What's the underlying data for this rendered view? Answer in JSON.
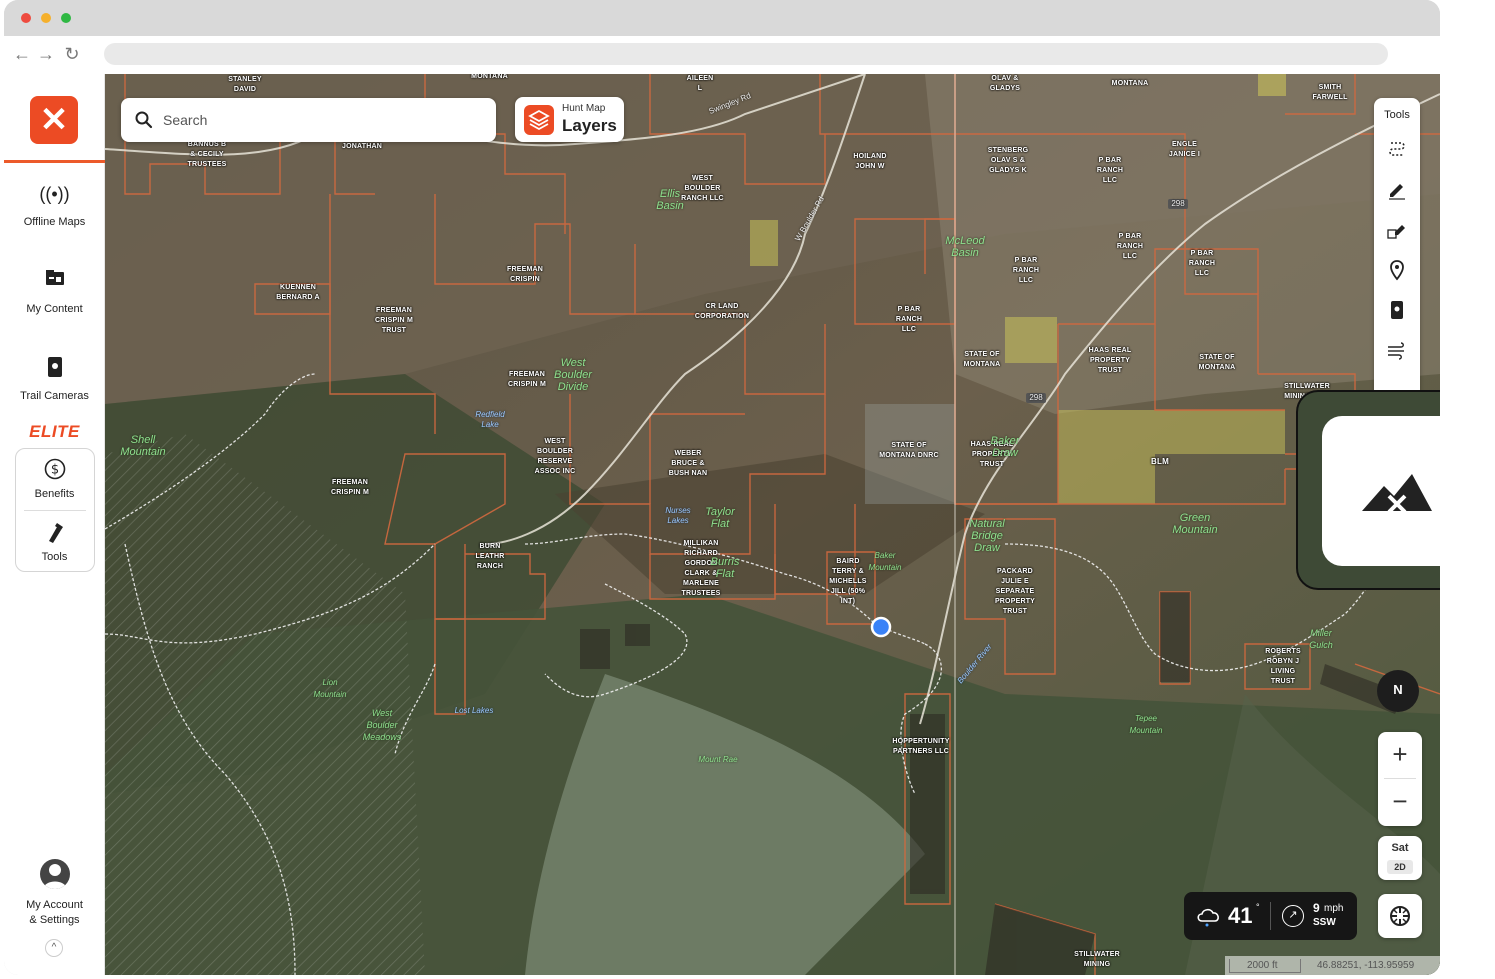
{
  "browser": {
    "url": ""
  },
  "sidebar": {
    "items": [
      {
        "label": "Offline Maps",
        "icon": "offline-maps-icon"
      },
      {
        "label": "My Content",
        "icon": "my-content-icon"
      },
      {
        "label": "Trail Cameras",
        "icon": "trail-camera-icon"
      }
    ],
    "elite_label": "ELITE",
    "elite_items": [
      {
        "label": "Benefits",
        "icon": "benefits-icon"
      },
      {
        "label": "Tools",
        "icon": "tools-icon"
      }
    ],
    "account_label_1": "My Account",
    "account_label_2": "& Settings"
  },
  "search": {
    "placeholder": "Search"
  },
  "layers_button": {
    "small": "Hunt Map",
    "big": "Layers"
  },
  "tools_panel": {
    "title": "Tools"
  },
  "compass": {
    "label": "N"
  },
  "zoom": {
    "in": "+",
    "out": "−"
  },
  "map_style": {
    "top": "Sat",
    "bottom": "2D"
  },
  "weather": {
    "temperature": "41",
    "degree": "°",
    "wind_speed": "9",
    "wind_unit": "mph",
    "wind_direction": "SSW"
  },
  "scale": {
    "label": "2000 ft"
  },
  "coordinates": "46.88251, -113.95959",
  "colors": {
    "brand": "#ec4b24",
    "boundary": "#d2693f",
    "public_land": "#c9c25a"
  },
  "map_labels": {
    "ownership": [
      "STANLEY DAVID",
      "MONTANA",
      "AILEEN L",
      "OLAV & GLADYS",
      "MONTANA",
      "SMITH FARWELL",
      "BANNUS B & CECILY TRUSTEES",
      "JONATHAN",
      "HOILAND JOHN W",
      "STENBERG OLAV S & GLADYS K",
      "P BAR RANCH LLC",
      "ENGLE JANICE I",
      "WEST BOULDER RANCH LLC",
      "P BAR RANCH LLC",
      "P BAR RANCH LLC",
      "P BAR RANCH LLC",
      "FREEMAN CRISPIN",
      "KUENNEN BERNARD A",
      "FREEMAN CRISPIN M TRUST",
      "CR LAND CORPORATION",
      "P BAR RANCH LLC",
      "STATE OF MONTANA",
      "HAAS REAL PROPERTY TRUST",
      "STATE OF MONTANA",
      "STILLWATER MINING COM",
      "FREEMAN CRISPIN M",
      "WEST BOULDER RESERVE ASSOC INC",
      "WEBER BRUCE & BUSH NAN",
      "STATE OF MONTANA DNRC",
      "HAAS REAL PROPERTY TRUST",
      "BLM",
      "FREEMAN CRISPIN M",
      "BURN LEATHR RANCH",
      "MILLIKAN RICHARD GORDON CLARK & MARLENE TRUSTEES",
      "BAIRD TERRY & MICHELLS JILL (50% INT)",
      "PACKARD JULIE E SEPARATE PROPERTY TRUST",
      "ROBERTS ROBYN J LIVING TRUST",
      "HOPPERTUNITY PARTNERS LLC",
      "STILLWATER MINING"
    ],
    "features": [
      "Ellis Basin",
      "McLeod Basin",
      "West Boulder Divide",
      "Shell Mountain",
      "Baker Draw",
      "Taylor Flat",
      "Burris Flat",
      "Natural Bridge Draw",
      "Green Mountain",
      "Baker Mountain",
      "Lion Mountain",
      "West Boulder Meadows",
      "Mount Rae",
      "Tepee Mountain",
      "Miller Gulch"
    ],
    "water": [
      "Redfield Lake",
      "Nurses Lakes",
      "Lost Lakes",
      "Boulder River"
    ],
    "roads": [
      "298",
      "298",
      "Swingley Rd",
      "W Boulder Rd"
    ]
  }
}
